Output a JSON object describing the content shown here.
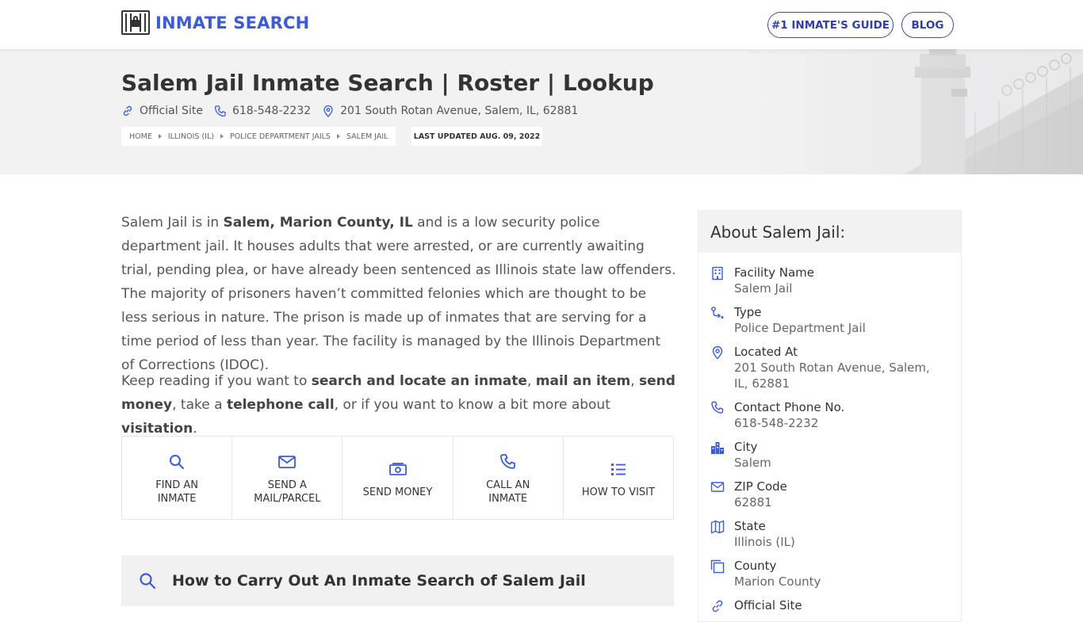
{
  "brand": {
    "name": "INMATE SEARCH"
  },
  "nav": {
    "guide_label": "#1 INMATE'S GUIDE",
    "blog_label": "BLOG"
  },
  "hero": {
    "title": "Salem Jail Inmate Search | Roster | Lookup",
    "official_site": "Official Site",
    "phone": "618-548-2232",
    "address": "201 South Rotan Avenue, Salem, IL, 62881",
    "breadcrumbs": [
      "HOME",
      "ILLINOIS (IL)",
      "POLICE DEPARTMENT JAILS",
      "SALEM JAIL"
    ],
    "last_updated": "LAST UPDATED AUG. 09, 2022"
  },
  "intro": {
    "p1_a": "Salem Jail is in ",
    "p1_b": "Salem, Marion County, IL",
    "p1_c": " and is a low security police department jail. It houses adults that were arrested, or are currently awaiting trial, pending plea, or have already been sentenced as Illinois state law offenders. The majority of prisoners haven’t committed felonies which are thought to be less serious in nature. The prison is made up of inmates that are serving for a time period of less than year. The facility is managed by the Illinois Department of Corrections (IDOC).",
    "p2_a": "Keep reading if you want to ",
    "p2_b": "search and locate an inmate",
    "p2_c": ", ",
    "p2_d": "mail an item",
    "p2_e": ", ",
    "p2_f": "send money",
    "p2_g": ", take a ",
    "p2_h": "telephone call",
    "p2_i": ", or if you want to know a bit more about ",
    "p2_j": "visitation",
    "p2_k": "."
  },
  "actions": [
    {
      "line1": "FIND AN",
      "line2": "INMATE",
      "icon": "search-icon"
    },
    {
      "line1": "SEND A",
      "line2": "MAIL/PARCEL",
      "icon": "mail-icon"
    },
    {
      "line1": "SEND MONEY",
      "line2": "",
      "icon": "money-icon"
    },
    {
      "line1": "CALL AN",
      "line2": "INMATE",
      "icon": "phone-icon"
    },
    {
      "line1": "HOW TO VISIT",
      "line2": "",
      "icon": "list-icon"
    }
  ],
  "faq": {
    "question": "How to Carry Out An Inmate Search of Salem Jail"
  },
  "about": {
    "heading": "About Salem Jail:",
    "items": [
      {
        "key": "Facility Name",
        "value": "Salem Jail",
        "icon": "building-icon"
      },
      {
        "key": "Type",
        "value": "Police Department Jail",
        "icon": "route-icon"
      },
      {
        "key": "Located At",
        "value": "201 South Rotan Avenue, Salem, IL, 62881",
        "icon": "location-pin-icon"
      },
      {
        "key": "Contact Phone No.",
        "value": "618-548-2232",
        "icon": "phone-icon"
      },
      {
        "key": "City",
        "value": "Salem",
        "icon": "city-icon"
      },
      {
        "key": "ZIP Code",
        "value": "62881",
        "icon": "mail-icon"
      },
      {
        "key": "State",
        "value": "Illinois (IL)",
        "icon": "map-icon"
      },
      {
        "key": "County",
        "value": "Marion County",
        "icon": "copy-icon"
      },
      {
        "key": "Official Site",
        "value": "",
        "icon": "link-icon"
      }
    ]
  },
  "colors": {
    "accent": "#3b5bdb",
    "nav_border": "#3a4ab0",
    "hero_bg": "#f2f2f3"
  }
}
